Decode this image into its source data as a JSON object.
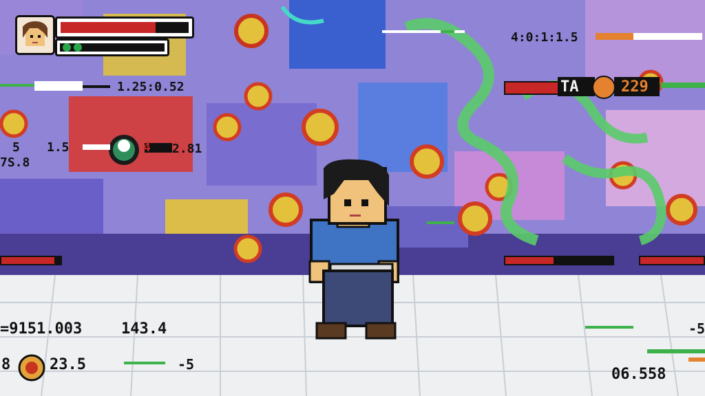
{
  "player": {
    "name_icon": "player-portrait-icon",
    "health_level": 0.74,
    "energy_orbs": 2
  },
  "enemy": {
    "tag": "TA",
    "hp": "229",
    "icon": "owl-badge-icon",
    "health_level": 0.45
  },
  "debug": {
    "top_right_readout": "4:0:1:1.5",
    "mid_left_readout": "1.25:0.52",
    "left_value_a": "5",
    "left_value_b": "1.5",
    "left_value_c": "2.81",
    "left_value_d": "7S.8",
    "coord_readout": "=9151.003",
    "coord_readout_b": "143.4",
    "bottom_left_count": "8",
    "bottom_left_value": "23.5",
    "bottom_left_delta": "-5",
    "bottom_right_value": "06.558",
    "right_delta": "-5",
    "marker_red": "4"
  },
  "colors": {
    "health_red": "#c82727",
    "energy_green": "#29a84a",
    "floor_white": "#eef0f2",
    "wall_purple": "#8c7fd0"
  }
}
